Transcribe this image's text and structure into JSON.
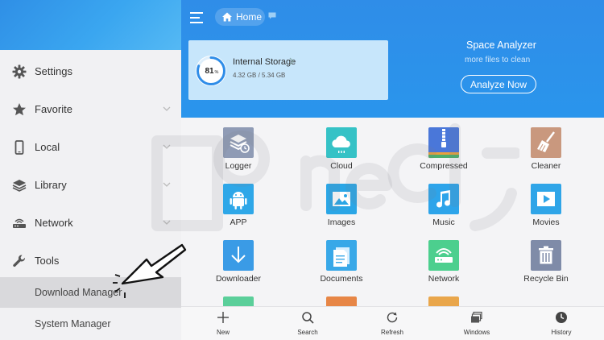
{
  "sidebar": {
    "items": [
      {
        "label": "Settings",
        "icon": "gear-icon"
      },
      {
        "label": "Favorite",
        "icon": "star-icon"
      },
      {
        "label": "Local",
        "icon": "phone-icon"
      },
      {
        "label": "Library",
        "icon": "layers-icon"
      },
      {
        "label": "Network",
        "icon": "router-icon"
      },
      {
        "label": "Tools",
        "icon": "wrench-icon"
      }
    ],
    "subitems": [
      {
        "label": "Download Manager"
      },
      {
        "label": "System Manager"
      }
    ]
  },
  "topbar": {
    "home_label": "Home"
  },
  "storage": {
    "percent": "81",
    "percent_sign": "%",
    "percent_value": 81,
    "title": "Internal Storage",
    "size": "4.32 GB / 5.34 GB"
  },
  "analyzer": {
    "title": "Space Analyzer",
    "subtitle": "more files to clean",
    "button": "Analyze Now"
  },
  "grid": [
    {
      "label": "Logger",
      "icon": "logger-icon",
      "color": "#8f9bb5"
    },
    {
      "label": "Cloud",
      "icon": "cloud-icon",
      "color": "#35c2c6"
    },
    {
      "label": "Compressed",
      "icon": "archive-icon",
      "color": "#4a77d9"
    },
    {
      "label": "Cleaner",
      "icon": "broom-icon",
      "color": "#c9987e"
    },
    {
      "label": "APP",
      "icon": "android-icon",
      "color": "#2ea7e8"
    },
    {
      "label": "Images",
      "icon": "image-icon",
      "color": "#2aa6e6"
    },
    {
      "label": "Music",
      "icon": "music-icon",
      "color": "#2da4ea"
    },
    {
      "label": "Movies",
      "icon": "movie-icon",
      "color": "#2fa5e8"
    },
    {
      "label": "Downloader",
      "icon": "download-icon",
      "color": "#3a9be6"
    },
    {
      "label": "Documents",
      "icon": "document-icon",
      "color": "#38a8e8"
    },
    {
      "label": "Network",
      "icon": "network-icon",
      "color": "#4ccf8e"
    },
    {
      "label": "Recycle Bin",
      "icon": "trash-icon",
      "color": "#7f8ba8"
    }
  ],
  "grid_partial_colors": [
    "#5bcf9a",
    "#e78646",
    "#e9a64b"
  ],
  "bottom": {
    "new": "New",
    "search": "Search",
    "refresh": "Refresh",
    "windows": "Windows",
    "history": "History"
  },
  "colors": {
    "primary": "#2f8de8",
    "card": "#c7e6fb"
  }
}
